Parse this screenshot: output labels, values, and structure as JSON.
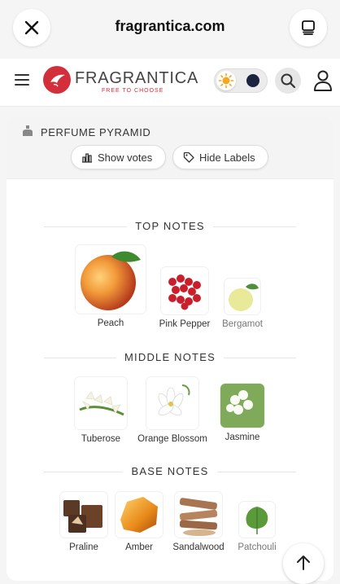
{
  "browser": {
    "url": "fragrantica.com",
    "close_icon": "close-icon",
    "tabs_icon": "tabs-icon"
  },
  "header": {
    "logo_text_main": "FRAGRANTICA",
    "logo_tagline": "FREE TO CHOOSE",
    "brand_color": "#d32f3a",
    "theme_light_icon": "sun-icon",
    "theme_dark_icon": "moon-icon"
  },
  "pyramid": {
    "title": "PERFUME PYRAMID",
    "show_votes_label": "Show votes",
    "hide_labels_label": "Hide Labels",
    "sections": {
      "top": {
        "title": "TOP NOTES",
        "notes": [
          {
            "name": "Peach"
          },
          {
            "name": "Pink Pepper"
          },
          {
            "name": "Bergamot"
          }
        ]
      },
      "middle": {
        "title": "MIDDLE NOTES",
        "notes": [
          {
            "name": "Tuberose"
          },
          {
            "name": "Orange Blossom"
          },
          {
            "name": "Jasmine"
          }
        ]
      },
      "base": {
        "title": "BASE NOTES",
        "notes": [
          {
            "name": "Praline"
          },
          {
            "name": "Amber"
          },
          {
            "name": "Sandalwood"
          },
          {
            "name": "Patchouli"
          }
        ]
      }
    }
  }
}
